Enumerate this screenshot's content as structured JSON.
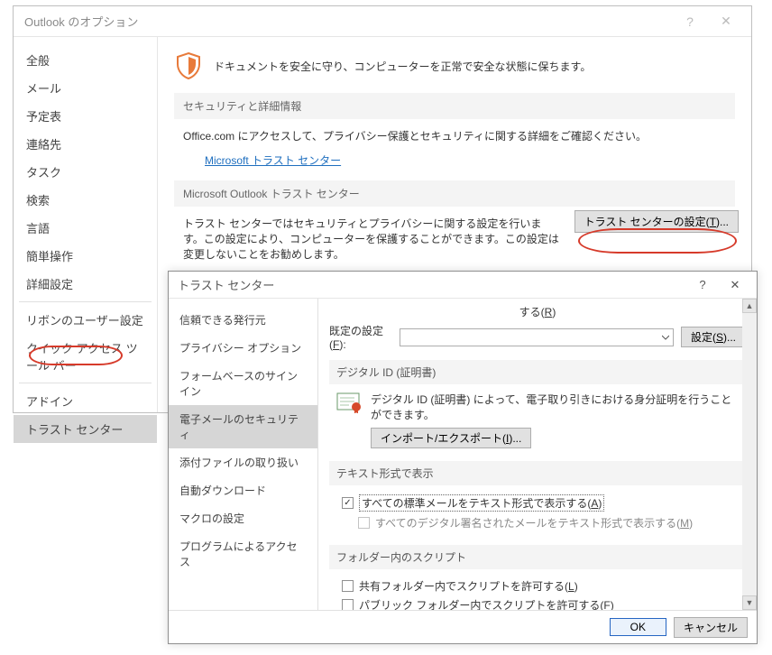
{
  "options": {
    "title": "Outlook のオプション",
    "sidebar": [
      "全般",
      "メール",
      "予定表",
      "連絡先",
      "タスク",
      "検索",
      "言語",
      "簡単操作",
      "詳細設定",
      "リボンのユーザー設定",
      "クイック アクセス ツール バー",
      "アドイン",
      "トラスト センター"
    ],
    "selected_index": 12,
    "headline": "ドキュメントを安全に守り、コンピューターを正常で安全な状態に保ちます。",
    "sec1_title": "セキュリティと詳細情報",
    "sec1_body": "Office.com にアクセスして、プライバシー保護とセキュリティに関する詳細をご確認ください。",
    "sec1_link": "Microsoft トラスト センター",
    "sec2_title": "Microsoft Outlook トラスト センター",
    "sec2_body": "トラスト センターではセキュリティとプライバシーに関する設定を行います。この設定により、コンピューターを保護することができます。この設定は変更しないことをお勧めします。",
    "tc_button_pre": "トラスト センターの設定(",
    "tc_button_u": "T",
    "tc_button_post": ")..."
  },
  "trust": {
    "title": "トラスト センター",
    "sidebar": [
      "信頼できる発行元",
      "プライバシー オプション",
      "フォームベースのサインイン",
      "電子メールのセキュリティ",
      "添付ファイルの取り扱い",
      "自動ダウンロード",
      "マクロの設定",
      "プログラムによるアクセス"
    ],
    "selected_index": 3,
    "top_suru_pre": "する(",
    "top_suru_u": "R",
    "top_suru_post": ")",
    "default_label_line1": "既定の設定",
    "default_label_line2_pre": "(",
    "default_label_line2_u": "F",
    "default_label_line2_post": "):",
    "settings_btn_pre": "設定(",
    "settings_btn_u": "S",
    "settings_btn_post": ")...",
    "digid_title": "デジタル ID (証明書)",
    "digid_body": "デジタル ID (証明書) によって、電子取り引きにおける身分証明を行うことができます。",
    "impexp_pre": "インポート/エクスポート(",
    "impexp_u": "I",
    "impexp_post": ")...",
    "textfmt_title": "テキスト形式で表示",
    "cb1_pre": "すべての標準メールをテキスト形式で表示する(",
    "cb1_u": "A",
    "cb1_post": ")",
    "cb2_pre": "すべてのデジタル署名されたメールをテキスト形式で表示する(",
    "cb2_u": "M",
    "cb2_post": ")",
    "folder_title": "フォルダー内のスクリプト",
    "cb3_pre": "共有フォルダー内でスクリプトを許可する(",
    "cb3_u": "L",
    "cb3_post": ")",
    "cb4_pre": "パブリック フォルダー内でスクリプトを許可する(",
    "cb4_u": "F",
    "cb4_post": ")",
    "ok": "OK",
    "cancel": "キャンセル"
  }
}
